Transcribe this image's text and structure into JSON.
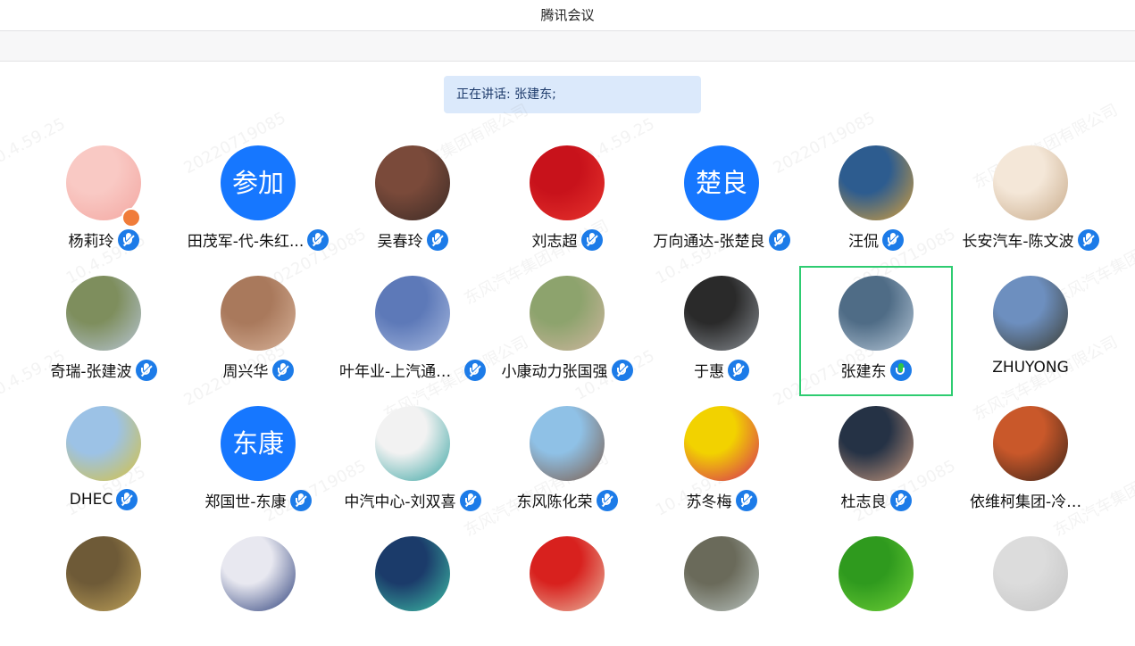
{
  "window": {
    "title": "腾讯会议"
  },
  "speaking_banner": {
    "text": "正在讲话: 张建东;"
  },
  "watermark": {
    "texts": [
      "10.4.59.25",
      "20220719085",
      "东风汽车集团有限公司"
    ]
  },
  "participants": [
    {
      "name": "杨莉玲",
      "avatar_type": "image",
      "avatar_colors": [
        "#f9c9c4",
        "#f3a6a0"
      ],
      "mic": "muted",
      "badge": true
    },
    {
      "name": "田茂军-代-朱红...",
      "avatar_type": "text",
      "avatar_text": "参加",
      "mic": "muted"
    },
    {
      "name": "吴春玲",
      "avatar_type": "image",
      "avatar_colors": [
        "#7a4a3a",
        "#3a2a25"
      ],
      "mic": "muted"
    },
    {
      "name": "刘志超",
      "avatar_type": "image",
      "avatar_colors": [
        "#c8121b",
        "#e8352e"
      ],
      "mic": "muted"
    },
    {
      "name": "万向通达-张楚良",
      "avatar_type": "text",
      "avatar_text": "楚良",
      "mic": "muted"
    },
    {
      "name": "汪侃",
      "avatar_type": "image",
      "avatar_colors": [
        "#2d5c8f",
        "#d9a13a"
      ],
      "mic": "muted"
    },
    {
      "name": "长安汽车-陈文波",
      "avatar_type": "image",
      "avatar_colors": [
        "#f4e7d8",
        "#c7a988"
      ],
      "mic": "muted"
    },
    {
      "name": "奇瑞-张建波",
      "avatar_type": "image",
      "avatar_colors": [
        "#7e8e5d",
        "#b8c6d6"
      ],
      "mic": "muted"
    },
    {
      "name": "周兴华",
      "avatar_type": "image",
      "avatar_colors": [
        "#a9795c",
        "#d8b39a"
      ],
      "mic": "muted"
    },
    {
      "name": "叶年业-上汽通用...",
      "avatar_type": "image",
      "avatar_colors": [
        "#5d79b8",
        "#a7b9df"
      ],
      "mic": "muted"
    },
    {
      "name": "小康动力张国强",
      "avatar_type": "image",
      "avatar_colors": [
        "#8da36d",
        "#d0b7a0"
      ],
      "mic": "muted"
    },
    {
      "name": "于惠",
      "avatar_type": "image",
      "avatar_colors": [
        "#2a2a2a",
        "#8a8f95"
      ],
      "mic": "muted"
    },
    {
      "name": "张建东",
      "avatar_type": "image",
      "avatar_colors": [
        "#4f6c86",
        "#b7c8d8"
      ],
      "mic": "active",
      "highlighted": true
    },
    {
      "name": "ZHUYONG",
      "avatar_type": "image",
      "avatar_colors": [
        "#6d8fbf",
        "#3b3b2f"
      ],
      "mic": "none"
    },
    {
      "name": "DHEC",
      "avatar_type": "image",
      "avatar_colors": [
        "#9cc2e6",
        "#d8c23c"
      ],
      "mic": "muted"
    },
    {
      "name": "郑国世-东康",
      "avatar_type": "text",
      "avatar_text": "东康",
      "mic": "muted"
    },
    {
      "name": "中汽中心-刘双喜",
      "avatar_type": "image",
      "avatar_colors": [
        "#f2f2f2",
        "#36a3a1"
      ],
      "mic": "muted"
    },
    {
      "name": "东风陈化荣",
      "avatar_type": "image",
      "avatar_colors": [
        "#8fc1e6",
        "#7c5a48"
      ],
      "mic": "muted"
    },
    {
      "name": "苏冬梅",
      "avatar_type": "image",
      "avatar_colors": [
        "#f2d200",
        "#d6245c"
      ],
      "mic": "muted"
    },
    {
      "name": "杜志良",
      "avatar_type": "image",
      "avatar_colors": [
        "#253245",
        "#c99a7e"
      ],
      "mic": "muted"
    },
    {
      "name": "依维柯集团-冷雪鹰",
      "avatar_type": "image",
      "avatar_colors": [
        "#c9582a",
        "#3a2318"
      ],
      "mic": "none"
    },
    {
      "name": "",
      "avatar_type": "image",
      "avatar_colors": [
        "#6e5a37",
        "#c0a35a"
      ],
      "mic": "none"
    },
    {
      "name": "",
      "avatar_type": "image",
      "avatar_colors": [
        "#e8e8f0",
        "#2b3e7a"
      ],
      "mic": "none"
    },
    {
      "name": "",
      "avatar_type": "image",
      "avatar_colors": [
        "#1b3b6a",
        "#3fc2a8"
      ],
      "mic": "none"
    },
    {
      "name": "",
      "avatar_type": "image",
      "avatar_colors": [
        "#d8211e",
        "#e9b8a0"
      ],
      "mic": "none"
    },
    {
      "name": "",
      "avatar_type": "image",
      "avatar_colors": [
        "#6a6a5a",
        "#b9c3bf"
      ],
      "mic": "none"
    },
    {
      "name": "",
      "avatar_type": "image",
      "avatar_colors": [
        "#2f9a1e",
        "#6fd037"
      ],
      "mic": "none"
    },
    {
      "name": "",
      "avatar_type": "image",
      "avatar_colors": [
        "#dcdcdc",
        "#c4c4c4"
      ],
      "mic": "none"
    }
  ]
}
